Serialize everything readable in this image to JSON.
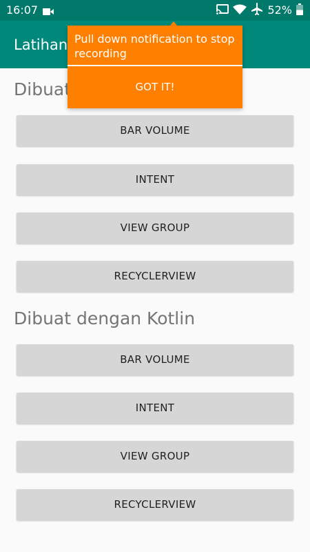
{
  "status_bar": {
    "time": "16:07",
    "battery_percent": "52%",
    "icons": [
      "video-camera-icon",
      "cast-icon",
      "wifi-icon",
      "airplane-icon",
      "battery-icon"
    ]
  },
  "app_bar": {
    "title": "Latihan"
  },
  "sections": {
    "java": {
      "heading": "Dibuat",
      "buttons": [
        "BAR VOLUME",
        "INTENT",
        "VIEW GROUP",
        "RECYCLERVIEW"
      ]
    },
    "kotlin": {
      "heading": "Dibuat dengan Kotlin",
      "buttons": [
        "BAR VOLUME",
        "INTENT",
        "VIEW GROUP",
        "RECYCLERVIEW"
      ]
    }
  },
  "coachmark": {
    "message": "Pull down notification to stop recording",
    "action": "GOT IT!"
  },
  "colors": {
    "status_bar": "#00796b",
    "app_bar": "#00897b",
    "coachmark": "#ff8000",
    "button": "#d6d6d6"
  }
}
